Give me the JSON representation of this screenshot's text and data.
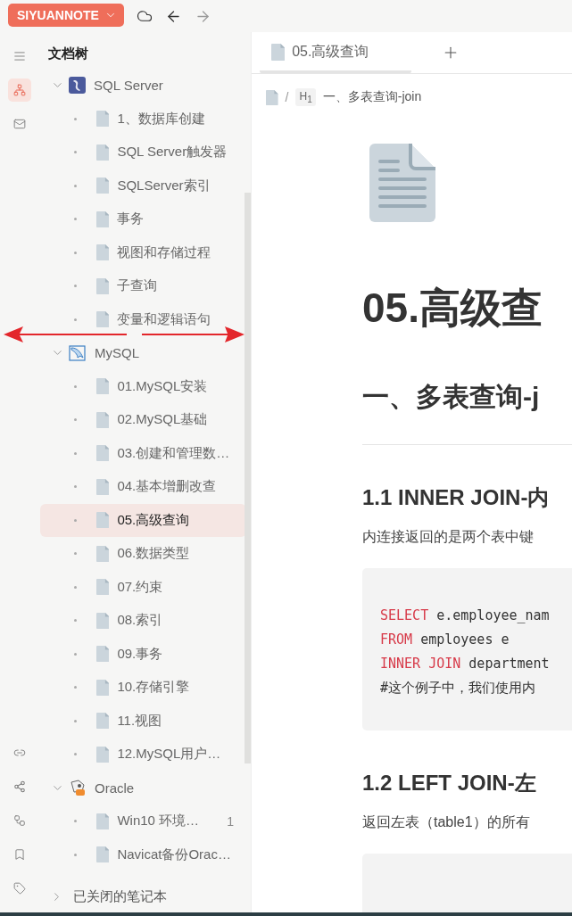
{
  "topbar": {
    "workspace": "SIYUANNOTE",
    "back_disabled": false,
    "forward_disabled": true
  },
  "rail_top": [
    {
      "kind": "outline",
      "selected": false
    },
    {
      "kind": "tree",
      "selected": true
    },
    {
      "kind": "inbox",
      "selected": false
    }
  ],
  "rail_bottom": [
    {
      "kind": "backlinks",
      "selected": false
    },
    {
      "kind": "graph",
      "selected": false
    },
    {
      "kind": "globalgraph",
      "selected": false
    },
    {
      "kind": "bookmark",
      "selected": false
    },
    {
      "kind": "tags",
      "selected": false
    }
  ],
  "tree": {
    "title": "文档树",
    "notebooks": [
      {
        "name": "SQL Server",
        "kind": "sqlserver",
        "expanded": true,
        "children": [
          {
            "title": "1、数据库创建",
            "selected": false
          },
          {
            "title": "SQL Server触发器",
            "selected": false
          },
          {
            "title": "SQLServer索引",
            "selected": false
          },
          {
            "title": "事务",
            "selected": false
          },
          {
            "title": "视图和存储过程",
            "selected": false
          },
          {
            "title": "子查询",
            "selected": false
          },
          {
            "title": "变量和逻辑语句",
            "selected": false
          }
        ]
      },
      {
        "name": "MySQL",
        "kind": "mysql",
        "expanded": true,
        "children": [
          {
            "title": "01.MySQL安装",
            "selected": false
          },
          {
            "title": "02.MySQL基础",
            "selected": false
          },
          {
            "title": "03.创建和管理数…",
            "selected": false
          },
          {
            "title": "04.基本增删改查",
            "selected": false
          },
          {
            "title": "05.高级查询",
            "selected": true
          },
          {
            "title": "06.数据类型",
            "selected": false
          },
          {
            "title": "07.约束",
            "selected": false
          },
          {
            "title": "08.索引",
            "selected": false
          },
          {
            "title": "09.事务",
            "selected": false
          },
          {
            "title": "10.存储引擎",
            "selected": false
          },
          {
            "title": "11.视图",
            "selected": false
          },
          {
            "title": "12.MySQL用户…",
            "selected": false
          }
        ]
      },
      {
        "name": "Oracle",
        "kind": "oracle",
        "expanded": true,
        "children": [
          {
            "title": "Win10 环境…",
            "count": "1",
            "selected": false
          },
          {
            "title": "Navicat备份Orac…",
            "selected": false
          }
        ]
      }
    ]
  },
  "closed_notebooks": {
    "label": "已关闭的笔记本",
    "expanded": false
  },
  "tabs": [
    {
      "title": "05.高级查询",
      "selected": true
    }
  ],
  "breadcrumb": {
    "separator": "/",
    "tag": "H$_{1}$",
    "heading": "一、多表查询-join"
  },
  "document": [
    {
      "kind": "title",
      "text": "05.高级查"
    },
    {
      "kind": "h1",
      "text": "一、多表查询-j"
    },
    {
      "kind": "h3",
      "text": "1.1 INNER JOIN-内"
    },
    {
      "kind": "p",
      "text": "内连接返回的是两个表中键"
    },
    {
      "kind": "code",
      "lines": [
        [
          {
            "kind": "keyword",
            "text": "SELECT"
          },
          {
            "kind": "plain",
            "text": " e.employee_nam"
          }
        ],
        [
          {
            "kind": "keyword",
            "text": "FROM"
          },
          {
            "kind": "plain",
            "text": " employees e"
          }
        ],
        [
          {
            "kind": "keyword",
            "text": "INNER JOIN"
          },
          {
            "kind": "plain",
            "text": " department"
          }
        ],
        [
          {
            "kind": "plain",
            "text": "#这个例子中，我们使用内"
          }
        ]
      ]
    },
    {
      "kind": "h3",
      "text": "1.2 LEFT JOIN-左"
    },
    {
      "kind": "p",
      "text": "返回左表（table1）的所有"
    },
    {
      "kind": "code"
    }
  ]
}
